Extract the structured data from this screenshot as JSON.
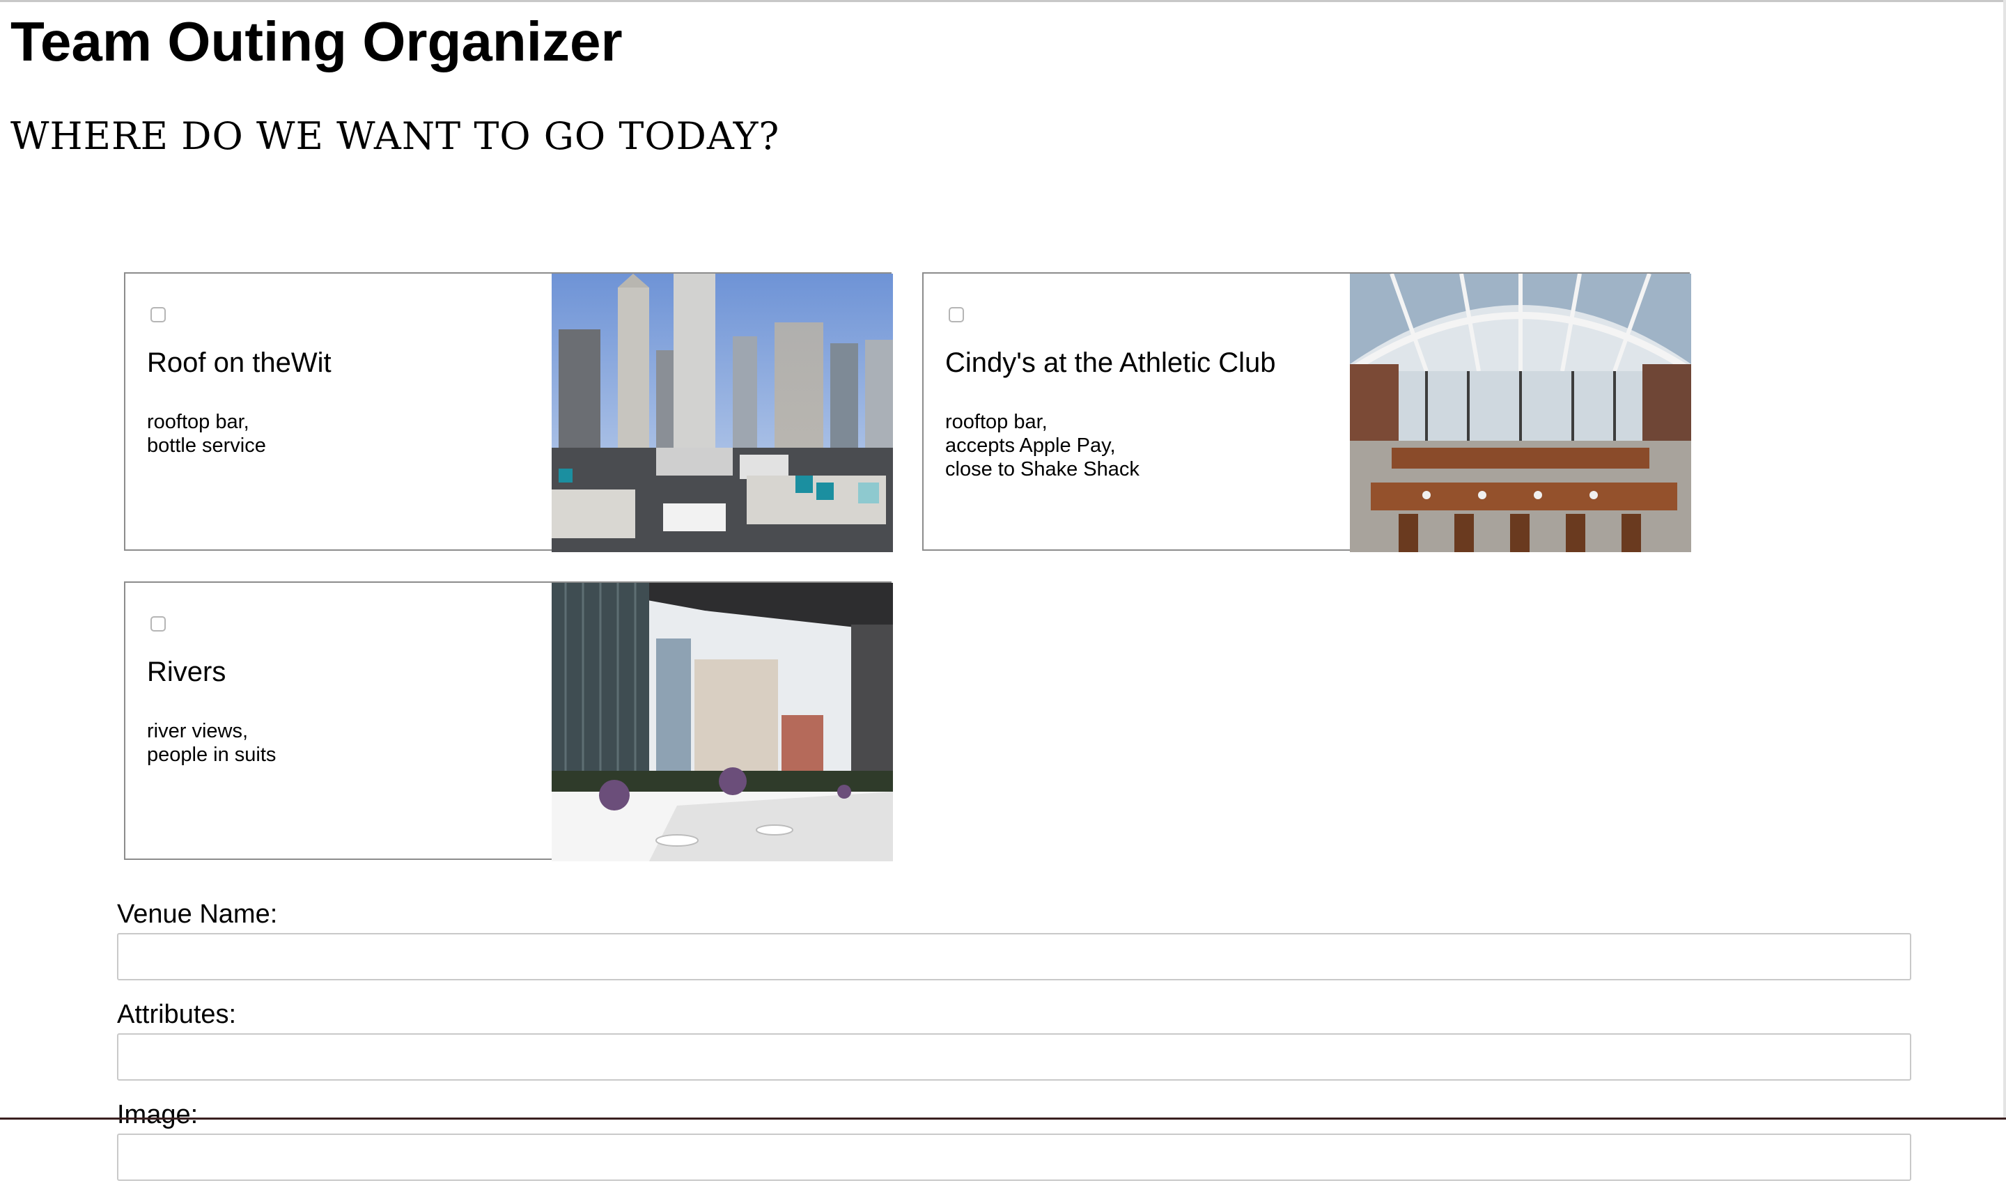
{
  "page": {
    "title": "Team Outing Organizer",
    "subtitle": "WHERE DO WE WANT TO GO TODAY?"
  },
  "venues": [
    {
      "name": "Roof on theWit",
      "attributes": [
        "rooftop bar,",
        "bottle service"
      ],
      "selected": false,
      "image_icon": "rooftop-lounge-photo"
    },
    {
      "name": "Cindy's at the Athletic Club",
      "attributes": [
        "rooftop bar,",
        "accepts Apple Pay,",
        "close to Shake Shack"
      ],
      "selected": false,
      "image_icon": "glass-dome-dining-photo"
    },
    {
      "name": "Rivers",
      "attributes": [
        "river views,",
        "people in suits"
      ],
      "selected": false,
      "image_icon": "river-terrace-dining-photo"
    }
  ],
  "form": {
    "venue_name_label": "Venue Name:",
    "venue_name_value": "",
    "attributes_label": "Attributes:",
    "attributes_value": "",
    "image_label": "Image:"
  }
}
